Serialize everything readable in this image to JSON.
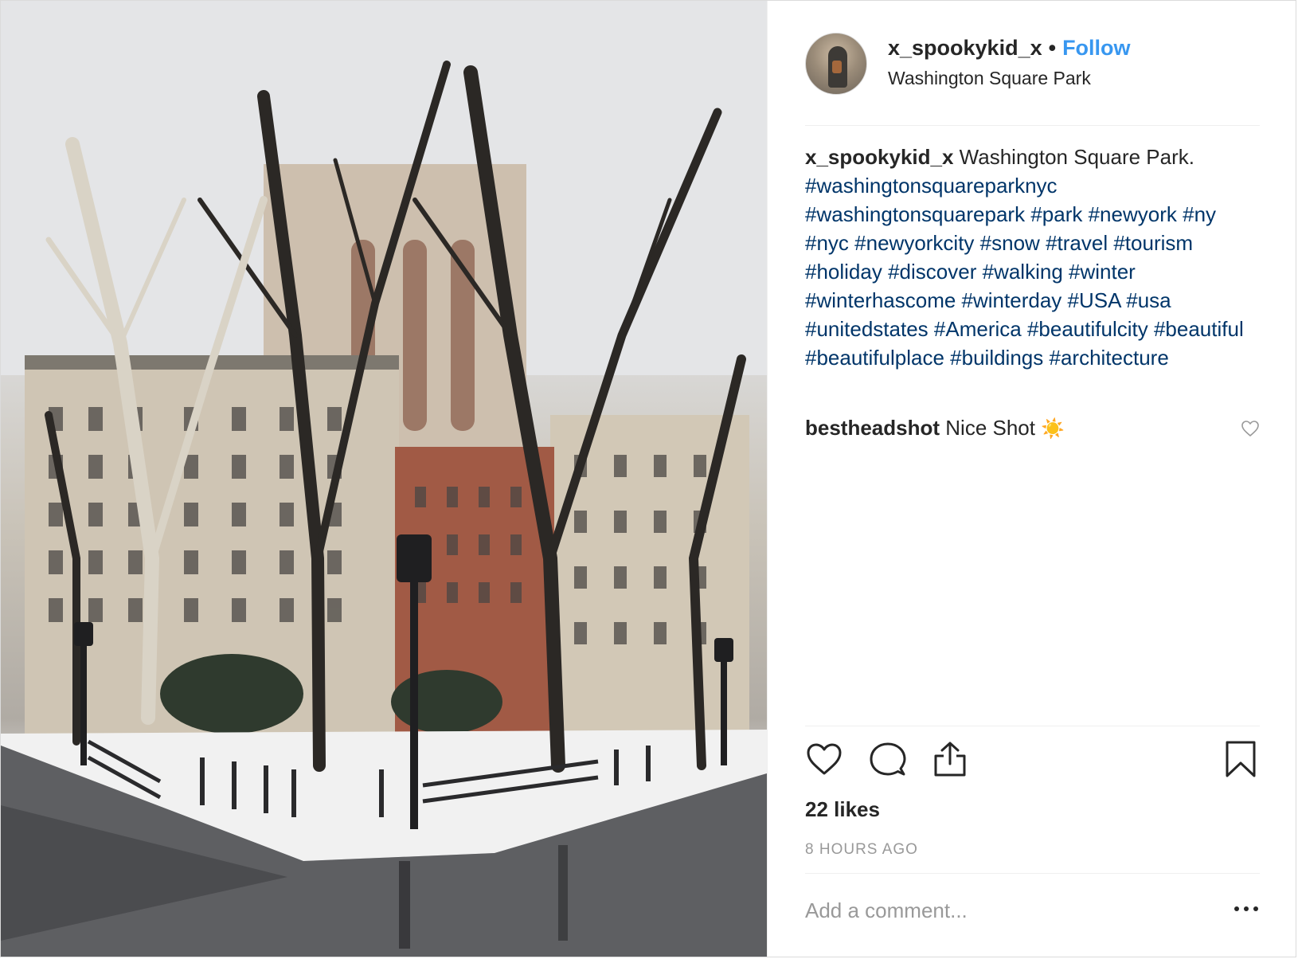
{
  "post": {
    "username": "x_spookykid_x",
    "dot": "•",
    "follow_label": "Follow",
    "location": "Washington Square Park"
  },
  "caption": {
    "username": "x_spookykid_x",
    "text": "Washington Square Park.",
    "hashtags": [
      "#washingtonsquareparknyc",
      "#washingtonsquarepark",
      "#park",
      "#newyork",
      "#ny",
      "#nyc",
      "#newyorkcity",
      "#snow",
      "#travel",
      "#tourism",
      "#holiday",
      "#discover",
      "#walking",
      "#winter",
      "#winterhascome",
      "#winterday",
      "#USA",
      "#usa",
      "#unitedstates",
      "#America",
      "#beautifulcity",
      "#beautiful",
      "#beautifulplace",
      "#buildings",
      "#architecture"
    ]
  },
  "comment": {
    "username": "bestheadshot",
    "text": "Nice Shot",
    "emoji": "☀️"
  },
  "stats": {
    "likes": "22 likes",
    "time": "8 HOURS AGO"
  },
  "input": {
    "placeholder": "Add a comment..."
  },
  "icons": {
    "like": "heart-icon",
    "comment": "comment-bubble-icon",
    "share": "share-icon",
    "save": "bookmark-icon",
    "comment_like": "heart-icon",
    "options": "more-options-icon"
  },
  "colors": {
    "follow": "#3897f0",
    "hashtag": "#003569",
    "muted": "#999999",
    "text": "#262626"
  }
}
